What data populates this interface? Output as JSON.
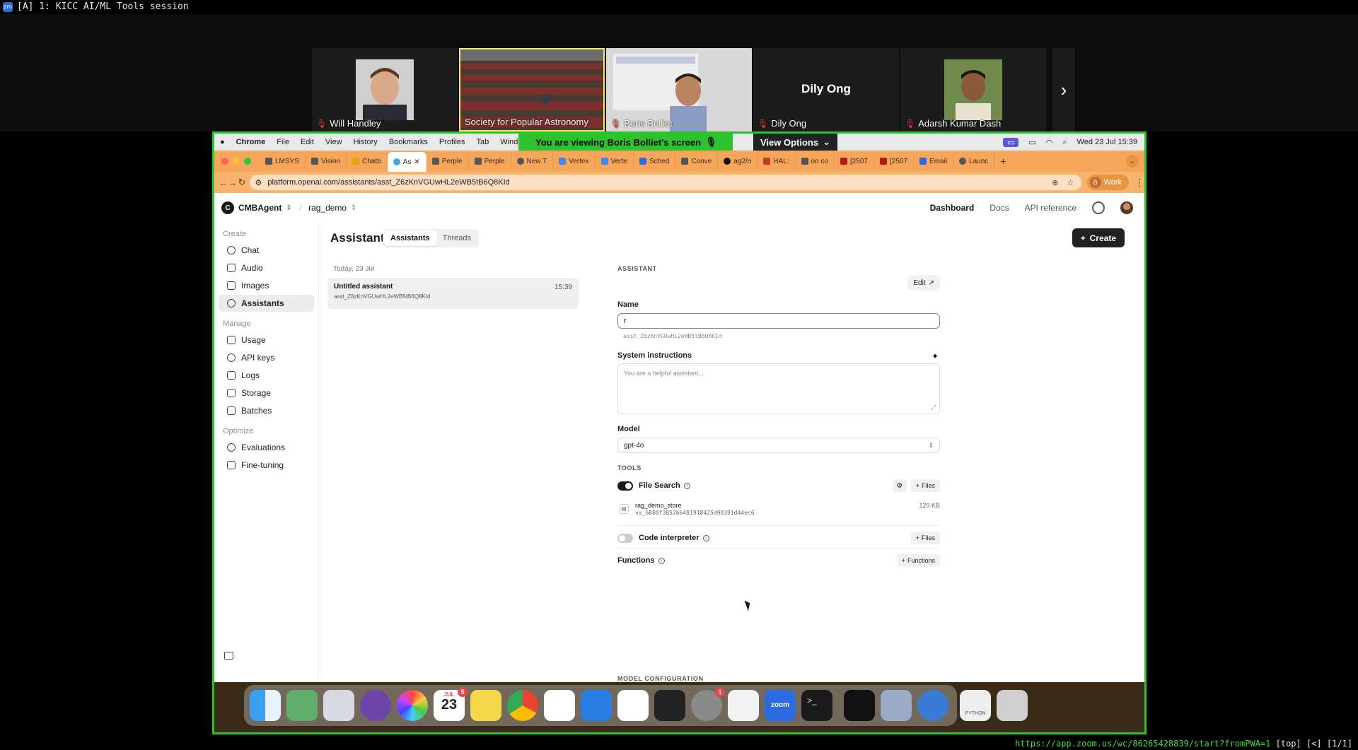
{
  "terminal": {
    "zm_label": "zm",
    "title": "[A] 1: KICC AI/ML Tools session"
  },
  "participants": [
    {
      "name": "Will Handley",
      "muted": true,
      "has_video": true
    },
    {
      "name": "Society for Popular Astronomy",
      "muted": false,
      "has_video": true,
      "active": true
    },
    {
      "name": "Boris Bolliet",
      "muted": true,
      "has_video": true
    },
    {
      "name": "Dily Ong",
      "muted": true,
      "has_video": false
    },
    {
      "name": "Adarsh Kumar Dash",
      "muted": true,
      "has_video": true
    }
  ],
  "zoom": {
    "viewing_banner": "You are viewing  Boris Bolliet's screen",
    "view_options": "View Options"
  },
  "macmenu": {
    "app": "Chrome",
    "items": [
      "File",
      "Edit",
      "View",
      "History",
      "Bookmarks",
      "Profiles",
      "Tab",
      "Windo"
    ],
    "datetime": "Wed 23 Jul  15:39"
  },
  "browser": {
    "tabs": [
      "LMSYS",
      "Vision",
      "Chatb",
      "As",
      "Perple",
      "Perple",
      "New T",
      "Vertex",
      "Verte",
      "Sched",
      "Conve",
      "ag2/n",
      "HAL:",
      "on co",
      "[2507",
      "[2507",
      "Email",
      "Launc"
    ],
    "active_tab_index": 3,
    "url": "platform.openai.com/assistants/asst_Z6zKnVGUwHL2eWB5tB6Q8KId",
    "profile": "Work",
    "profile_initial": "B"
  },
  "oa_header": {
    "org_initial": "C",
    "org": "CMBAgent",
    "project": "rag_demo",
    "nav": [
      "Dashboard",
      "Docs",
      "API reference"
    ]
  },
  "sidebar": {
    "sections": [
      {
        "title": "Create",
        "items": [
          "Chat",
          "Audio",
          "Images",
          "Assistants"
        ]
      },
      {
        "title": "Manage",
        "items": [
          "Usage",
          "API keys",
          "Logs",
          "Storage",
          "Batches"
        ]
      },
      {
        "title": "Optimize",
        "items": [
          "Evaluations",
          "Fine-tuning"
        ]
      }
    ],
    "active": "Assistants"
  },
  "main": {
    "title": "Assistants",
    "tabs": [
      "Assistants",
      "Threads"
    ],
    "create_label": "Create",
    "day_label": "Today, 23 Jul",
    "list": [
      {
        "name": "Untitled assistant",
        "id": "asst_Z6zKnVGUwHL2eWB5tB6Q8KId",
        "time": "15:39"
      }
    ]
  },
  "detail": {
    "section": "ASSISTANT",
    "edit_label": "Edit",
    "name_label": "Name",
    "name_value": "r",
    "asst_id": "asst_Z6zKnVGUwHL2eWB5tB6Q8KId",
    "sys_label": "System instructions",
    "sys_placeholder": "You are a helpful assistant...",
    "model_label": "Model",
    "model_value": "gpt-4o",
    "tools_label": "TOOLS",
    "file_search": {
      "label": "File Search",
      "on": true,
      "btn": "Files"
    },
    "store": {
      "name": "rag_demo_store",
      "id": "vs_6880f3852b6481918425d90391d44ec6",
      "size": "129 KB"
    },
    "code_interp": {
      "label": "Code interpreter",
      "on": false,
      "btn": "Files"
    },
    "functions": {
      "label": "Functions",
      "btn": "Functions"
    },
    "model_config": "MODEL CONFIGURATION"
  },
  "dock": {
    "calendar_month": "JUL",
    "calendar_day": "23",
    "calendar_badge": "5",
    "settings_badge": "1",
    "zoom_label": "zoom",
    "python_label": "PYTHON"
  },
  "status": {
    "url": "https://app.zoom.us/wc/86265428839/start?fromPWA=1",
    "rest": " [top] [<] [1/1]"
  }
}
